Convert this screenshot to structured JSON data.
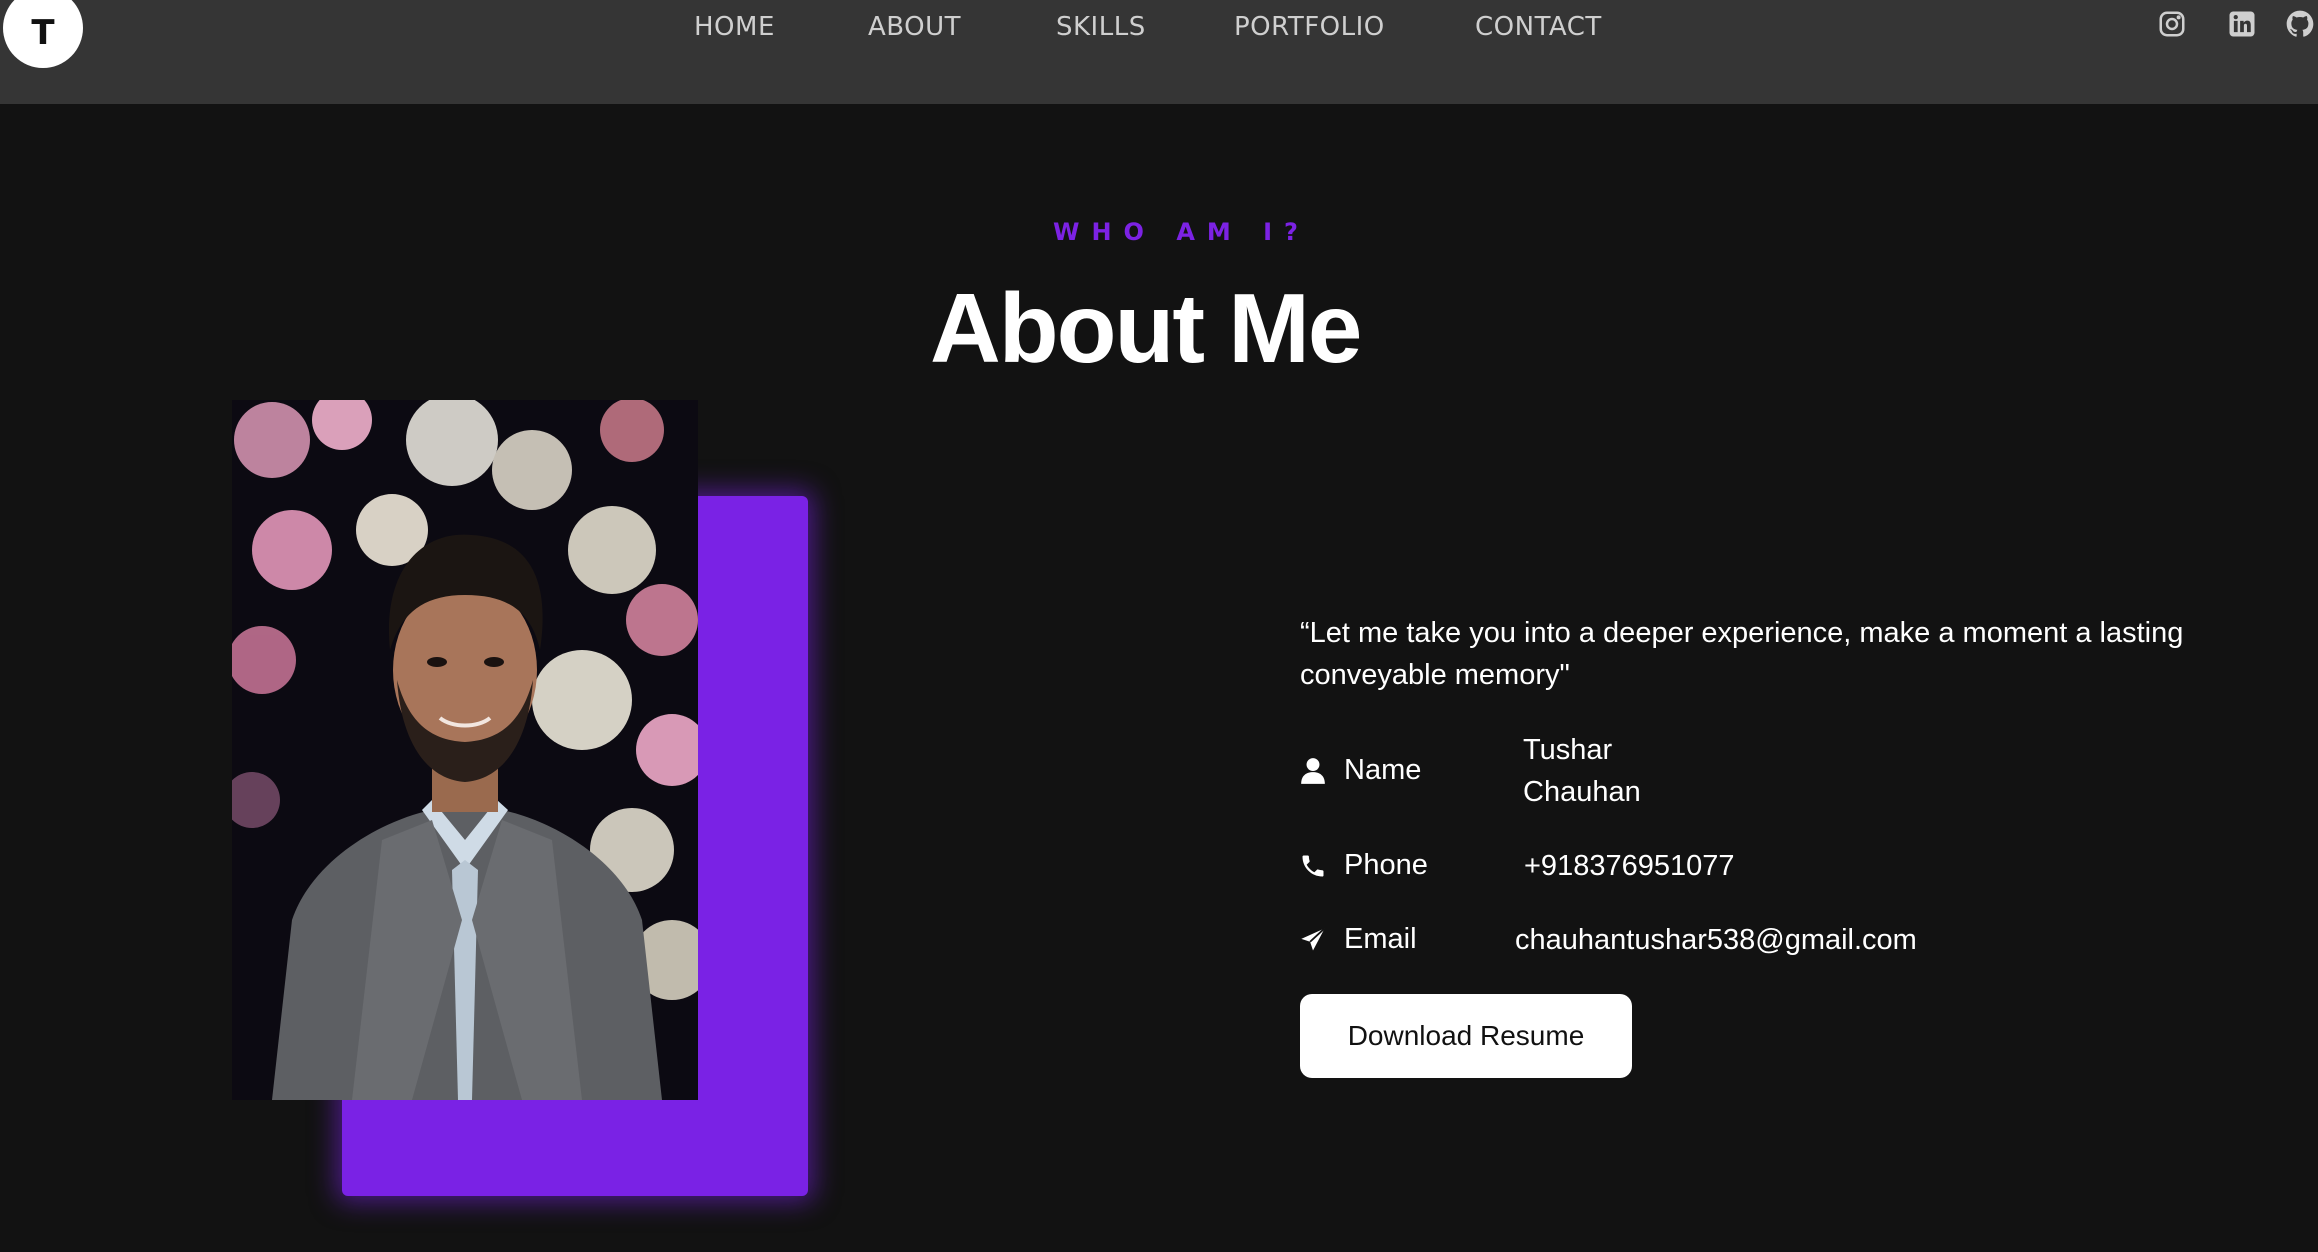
{
  "logo": {
    "letter": "T"
  },
  "nav": {
    "items": [
      {
        "label": "HOME"
      },
      {
        "label": "ABOUT"
      },
      {
        "label": "SKILLS"
      },
      {
        "label": "PORTFOLIO"
      },
      {
        "label": "CONTACT"
      }
    ]
  },
  "social": {
    "icons": [
      "instagram-icon",
      "linkedin-icon",
      "github-icon"
    ]
  },
  "section": {
    "eyebrow": "WHO AM I?",
    "title": "About Me"
  },
  "about": {
    "quote": "“Let me take you into a deeper experience, make a moment a lasting conveyable memory\"",
    "name_label": "Name",
    "name_value_line1": "Tushar",
    "name_value_line2": "Chauhan",
    "phone_label": "Phone",
    "phone_value": "+918376951077",
    "email_label": "Email",
    "email_value": "chauhantushar538@gmail.com",
    "resume_button": "Download Resume"
  },
  "colors": {
    "accent": "#7a22e5",
    "navbar": "#353535",
    "background": "#121212"
  }
}
